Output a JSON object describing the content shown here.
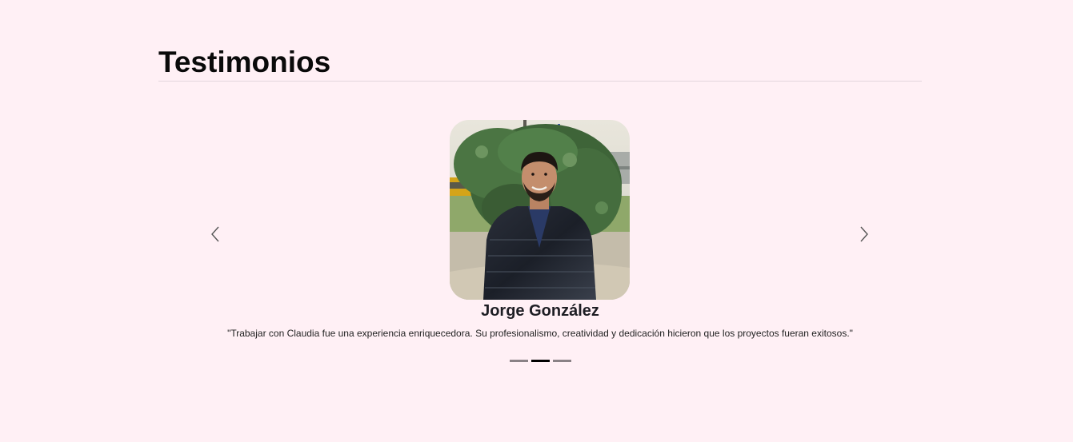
{
  "section": {
    "title": "Testimonios"
  },
  "carousel": {
    "prev_icon": "chevron-left-icon",
    "next_icon": "chevron-right-icon",
    "active_index": 1,
    "indicator_count": 3,
    "slide": {
      "name": "Jorge González",
      "quote": "\"Trabajar con Claudia fue una experiencia enriquecedora. Su profesionalismo, creatividad y dedicación hicieron que los proyectos fueran exitosos.\"",
      "photo_alt": "Jorge González"
    }
  },
  "colors": {
    "background": "#fff0f5",
    "indicator_inactive": "#8a8286",
    "indicator_active": "#000000"
  }
}
